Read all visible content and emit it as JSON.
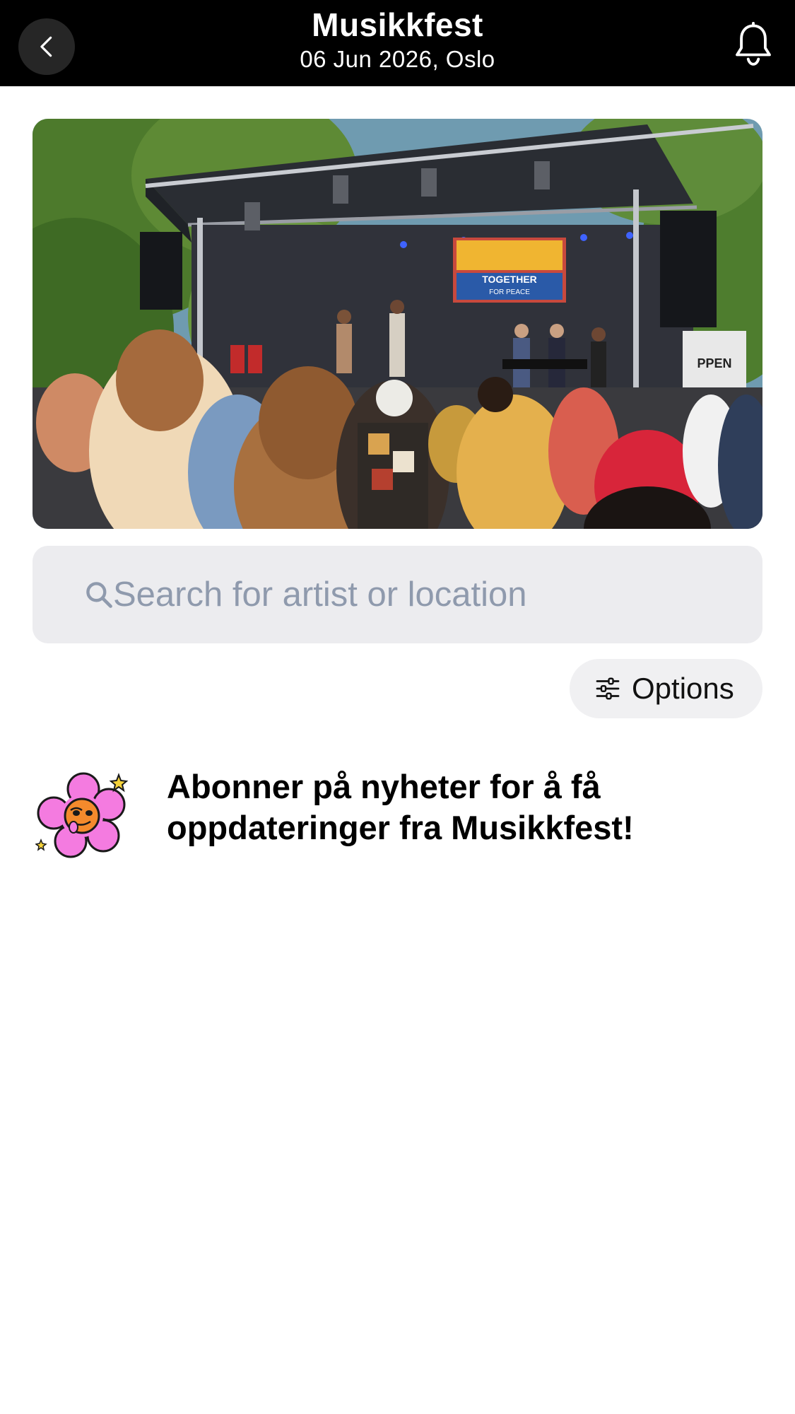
{
  "header": {
    "title": "Musikkfest",
    "subtitle": "06 Jun 2026, Oslo",
    "back_icon": "chevron-left-icon",
    "bell_icon": "bell-icon"
  },
  "hero": {
    "stage_banner_line1": "TOGETHER",
    "stage_banner_line2": "FOR PEACE",
    "sign_text": "PPEN"
  },
  "search": {
    "placeholder": "Search for artist or location",
    "value": ""
  },
  "options": {
    "label": "Options",
    "icon": "sliders-icon"
  },
  "newsletter": {
    "text": "Abonner på nyheter for å få oppdateringer fra Musikkfest!",
    "icon": "flower-mascot-icon"
  },
  "colors": {
    "header_bg": "#000000",
    "search_bg": "#ececef",
    "placeholder": "#8f9aad",
    "pill_bg": "#f0f0f2",
    "mascot_pink": "#f47be0",
    "mascot_orange": "#f48a2c"
  }
}
